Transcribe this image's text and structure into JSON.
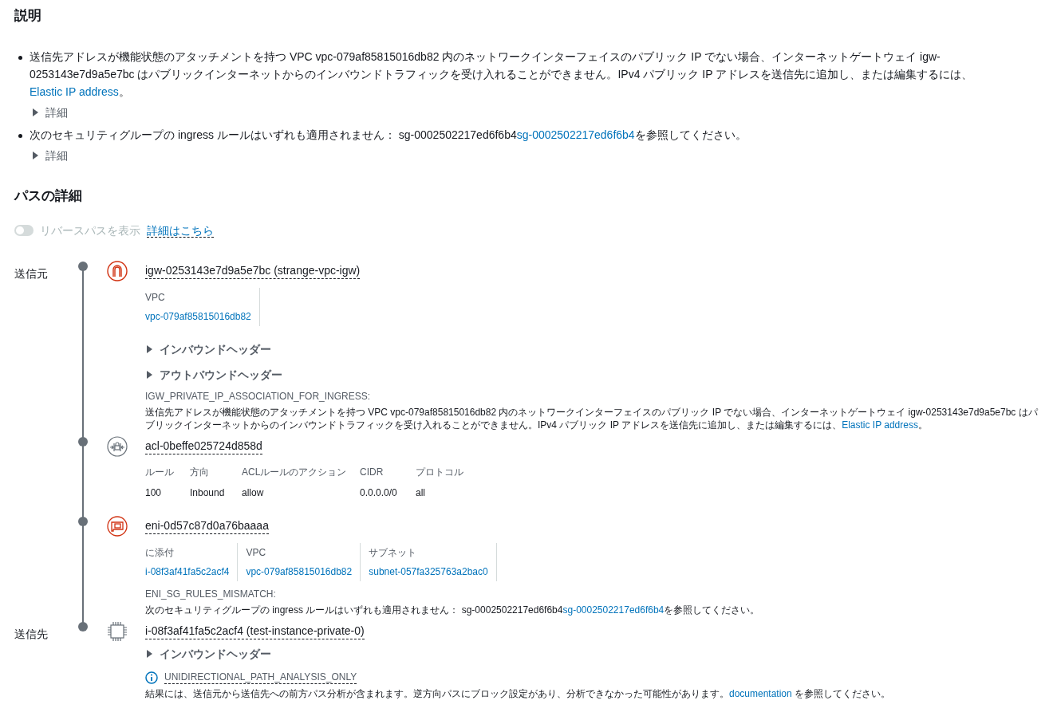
{
  "description": {
    "title": "説明",
    "items": [
      {
        "parts": [
          {
            "kind": "text",
            "text": "送信先アドレスが機能状態のアタッチメントを持つ VPC vpc-079af85815016db82 内のネットワークインターフェイスのパブリック IP でない場合、インターネットゲートウェイ igw-0253143e7d9a5e7bc はパブリックインターネットからのインバウンドトラフィックを受け入れることができません。IPv4 パブリック IP アドレスを送信先に追加し、または編集するには、"
          },
          {
            "kind": "link",
            "text": "Elastic IP address"
          },
          {
            "kind": "text",
            "text": "。"
          }
        ],
        "details": {
          "label": "詳細",
          "expanded": false
        }
      },
      {
        "parts": [
          {
            "kind": "text",
            "text": "次のセキュリティグループの ingress ルールはいずれも適用されません： sg-0002502217ed6f6b4"
          },
          {
            "kind": "link",
            "text": "sg-0002502217ed6f6b4"
          },
          {
            "kind": "text",
            "text": "を参照してください。"
          }
        ],
        "details": {
          "label": "詳細",
          "expanded": false
        }
      }
    ]
  },
  "path_details": {
    "title": "パスの詳細",
    "reverse_path": {
      "label": "リバースパスを表示",
      "on": false,
      "disabled": true
    },
    "learn_more": "詳細はこちら",
    "nodes": [
      {
        "side_label": "送信元",
        "kind": "igw",
        "title": "igw-0253143e7d9a5e7bc (strange-vpc-igw)",
        "fields": [
          {
            "label": "VPC",
            "value": "vpc-079af85815016db82"
          }
        ],
        "headers": [
          {
            "label": "インバウンドヘッダー",
            "expanded": false
          },
          {
            "label": "アウトバウンドヘッダー",
            "expanded": false
          }
        ],
        "finding": {
          "code": "IGW_PRIVATE_IP_ASSOCIATION_FOR_INGRESS:",
          "parts": [
            {
              "kind": "text",
              "text": "送信先アドレスが機能状態のアタッチメントを持つ VPC vpc-079af85815016db82 内のネットワークインターフェイスのパブリック IP でない場合、インターネットゲートウェイ igw-0253143e7d9a5e7bc はパブリックインターネットからのインバウンドトラフィックを受け入れることができません。IPv4 パブリック IP アドレスを送信先に追加し、または編集するには、"
            },
            {
              "kind": "link",
              "text": "Elastic IP address"
            },
            {
              "kind": "text",
              "text": "。"
            }
          ]
        }
      },
      {
        "kind": "acl",
        "title": "acl-0beffe025724d858d",
        "acl_table": {
          "columns": [
            "ルール",
            "方向",
            "ACLルールのアクション",
            "CIDR",
            "プロトコル"
          ],
          "rows": [
            [
              "100",
              "Inbound",
              "allow",
              "0.0.0.0/0",
              "all"
            ]
          ]
        }
      },
      {
        "kind": "eni",
        "title": "eni-0d57c87d0a76baaaa",
        "fields": [
          {
            "label": "に添付",
            "value": "i-08f3af41fa5c2acf4"
          },
          {
            "label": "VPC",
            "value": "vpc-079af85815016db82"
          },
          {
            "label": "サブネット",
            "value": "subnet-057fa325763a2bac0"
          }
        ],
        "finding": {
          "code": "ENI_SG_RULES_MISMATCH:",
          "parts": [
            {
              "kind": "text",
              "text": "次のセキュリティグループの ingress ルールはいずれも適用されません： sg-0002502217ed6f6b4"
            },
            {
              "kind": "link",
              "text": "sg-0002502217ed6f6b4"
            },
            {
              "kind": "text",
              "text": "を参照してください。"
            }
          ]
        }
      },
      {
        "side_label": "送信先",
        "kind": "instance",
        "title": "i-08f3af41fa5c2acf4 (test-instance-private-0)",
        "headers": [
          {
            "label": "インバウンドヘッダー",
            "expanded": false
          }
        ],
        "info": {
          "code": "UNIDIRECTIONAL_PATH_ANALYSIS_ONLY",
          "parts": [
            {
              "kind": "text",
              "text": "結果には、送信元から送信先への前方パス分析が含まれます。逆方向パスにブロック設定があり、分析できなかった可能性があります。"
            },
            {
              "kind": "link",
              "text": "documentation"
            },
            {
              "kind": "text",
              "text": " を参照してください。"
            }
          ]
        }
      }
    ]
  }
}
